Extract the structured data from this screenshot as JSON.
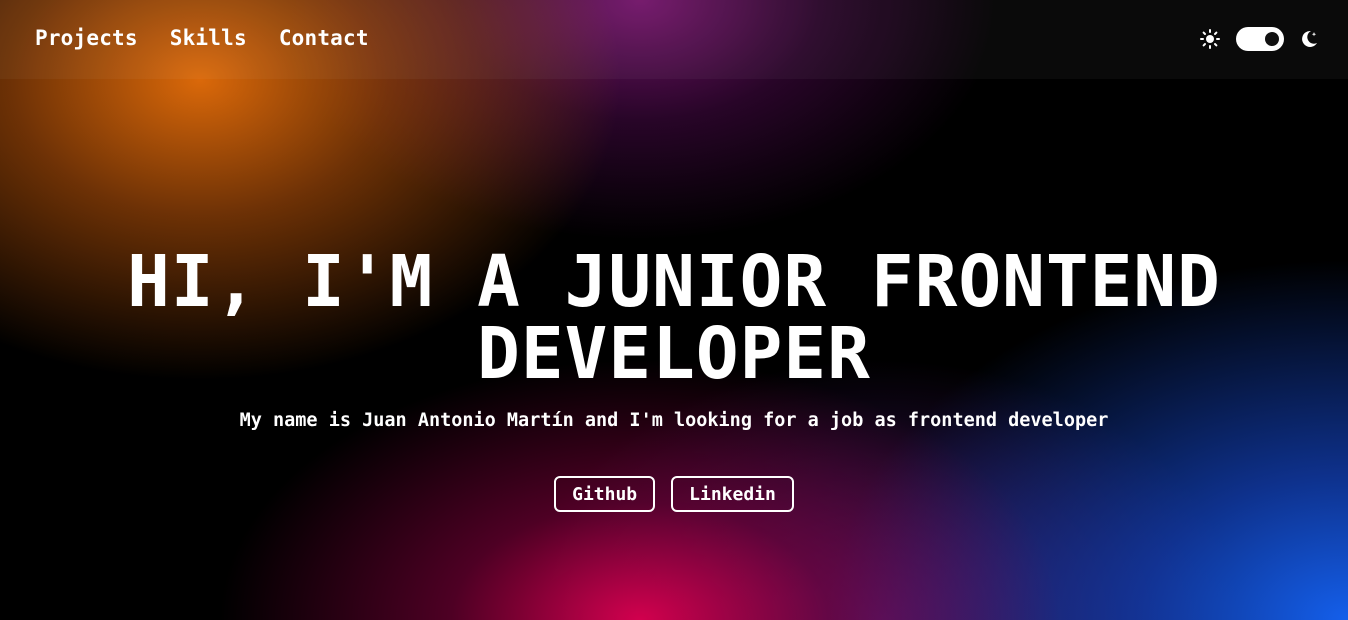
{
  "nav": {
    "items": [
      {
        "label": "Projects"
      },
      {
        "label": "Skills"
      },
      {
        "label": "Contact"
      }
    ]
  },
  "theme_switch": {
    "light_icon": "sun-icon",
    "dark_icon": "moon-icon",
    "state": "dark"
  },
  "hero": {
    "title_line1": "HI, I'M A JUNIOR FRONTEND",
    "title_line2": "DEVELOPER",
    "subtitle": "My name is Juan Antonio Martín and I'm looking for a job as frontend developer"
  },
  "buttons": {
    "github": "Github",
    "linkedin": "Linkedin"
  },
  "colors": {
    "background": "#000000",
    "orange_glow": "#E66E0A",
    "purple_glow": "#781470",
    "pink_glow": "#DC0050",
    "blue_glow": "#145FEB",
    "text": "#FFFFFF"
  }
}
